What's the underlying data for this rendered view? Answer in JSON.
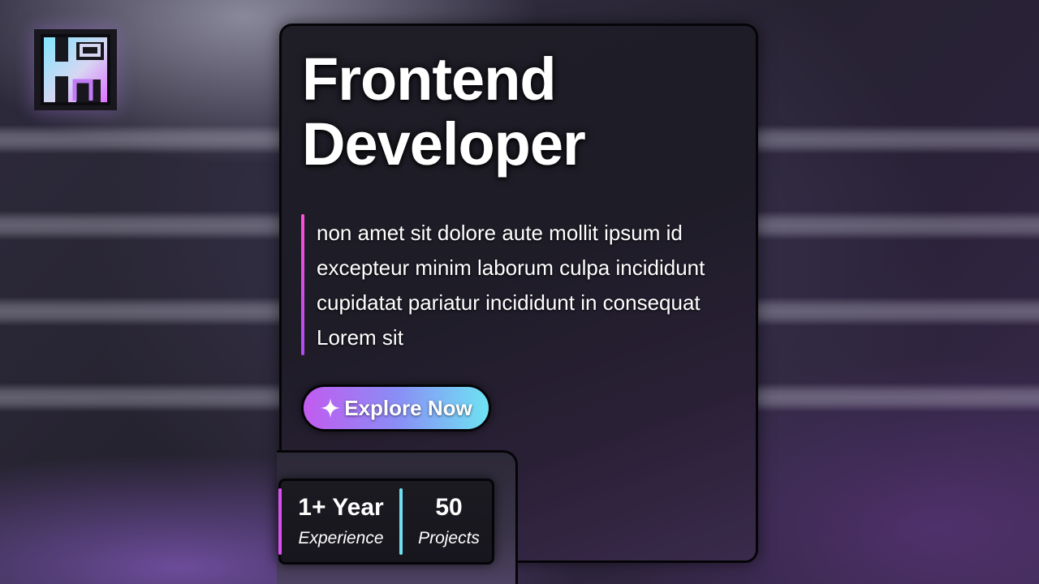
{
  "logo": {
    "icon": "hg-monogram-logo"
  },
  "hero": {
    "title_line1": "Frontend",
    "title_line2": "Developer",
    "description": "non amet sit dolore aute mollit ipsum id excepteur minim laborum culpa incididunt cupidatat pariatur incididunt in consequat Lorem sit"
  },
  "cta": {
    "icon": "sparkle-icon",
    "label": "Explore Now"
  },
  "stats": [
    {
      "value": "1+ Year",
      "label": "Experience"
    },
    {
      "value": "50",
      "label": "Projects"
    }
  ],
  "colors": {
    "accent_pink": "#d94ff0",
    "accent_cyan": "#6fe0ef",
    "button_gradient_start": "#c25bf0",
    "button_gradient_end": "#6ee3f3"
  }
}
